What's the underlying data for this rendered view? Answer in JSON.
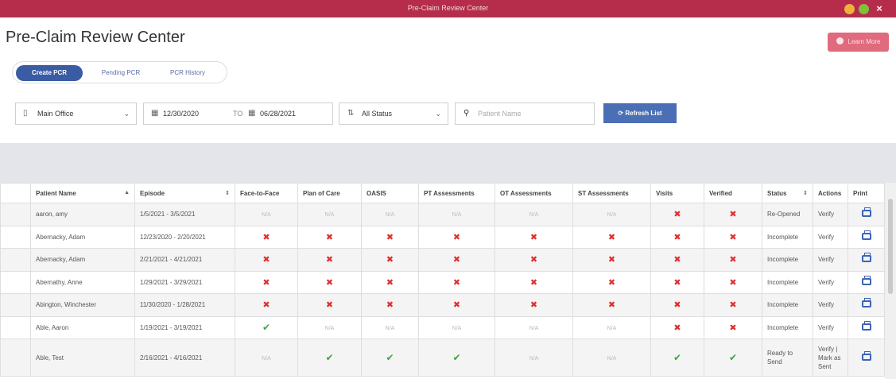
{
  "window": {
    "title": "Pre-Claim Review Center"
  },
  "page": {
    "title": "Pre-Claim Review Center",
    "learn_more": "Learn More"
  },
  "tabs": [
    "Create PCR",
    "Pending PCR",
    "PCR History"
  ],
  "filters": {
    "branch": "Main Office",
    "date_from": "12/30/2020",
    "date_sep": "TO",
    "date_to": "06/28/2021",
    "status": "All Status",
    "search_placeholder": "Patient Name",
    "refresh": "Refresh List"
  },
  "table": {
    "columns": [
      "Patient Name",
      "Episode",
      "Face-to-Face",
      "Plan of Care",
      "OASIS",
      "PT Assessments",
      "OT Assessments",
      "ST Assessments",
      "Visits",
      "Verified",
      "Status",
      "Actions",
      "Print"
    ],
    "rows": [
      {
        "name": "aaron, amy",
        "episode": "1/5/2021 - 3/5/2021",
        "f2f": "N/A",
        "poc": "N/A",
        "oasis": "N/A",
        "pt": "N/A",
        "ot": "N/A",
        "st": "N/A",
        "visits": "x",
        "verified": "x",
        "status": "Re-Opened",
        "action": "Verify"
      },
      {
        "name": "Abernacky, Adam",
        "episode": "12/23/2020 - 2/20/2021",
        "f2f": "x",
        "poc": "x",
        "oasis": "x",
        "pt": "x",
        "ot": "x",
        "st": "x",
        "visits": "x",
        "verified": "x",
        "status": "Incomplete",
        "action": "Verify"
      },
      {
        "name": "Abernacky, Adam",
        "episode": "2/21/2021 - 4/21/2021",
        "f2f": "x",
        "poc": "x",
        "oasis": "x",
        "pt": "x",
        "ot": "x",
        "st": "x",
        "visits": "x",
        "verified": "x",
        "status": "Incomplete",
        "action": "Verify"
      },
      {
        "name": "Abernathy, Anne",
        "episode": "1/29/2021 - 3/29/2021",
        "f2f": "x",
        "poc": "x",
        "oasis": "x",
        "pt": "x",
        "ot": "x",
        "st": "x",
        "visits": "x",
        "verified": "x",
        "status": "Incomplete",
        "action": "Verify"
      },
      {
        "name": "Abington, Winchester",
        "episode": "11/30/2020 - 1/28/2021",
        "f2f": "x",
        "poc": "x",
        "oasis": "x",
        "pt": "x",
        "ot": "x",
        "st": "x",
        "visits": "x",
        "verified": "x",
        "status": "Incomplete",
        "action": "Verify"
      },
      {
        "name": "Able, Aaron",
        "episode": "1/19/2021 - 3/19/2021",
        "f2f": "ok",
        "poc": "N/A",
        "oasis": "N/A",
        "pt": "N/A",
        "ot": "N/A",
        "st": "N/A",
        "visits": "x",
        "verified": "x",
        "status": "Incomplete",
        "action": "Verify"
      },
      {
        "name": "Able, Test",
        "episode": "2/16/2021 - 4/16/2021",
        "f2f": "N/A",
        "poc": "ok",
        "oasis": "ok",
        "pt": "ok",
        "ot": "N/A",
        "st": "N/A",
        "visits": "ok",
        "verified": "ok",
        "status": "Ready to Send",
        "action": "Verify | Mark as Sent"
      }
    ]
  }
}
